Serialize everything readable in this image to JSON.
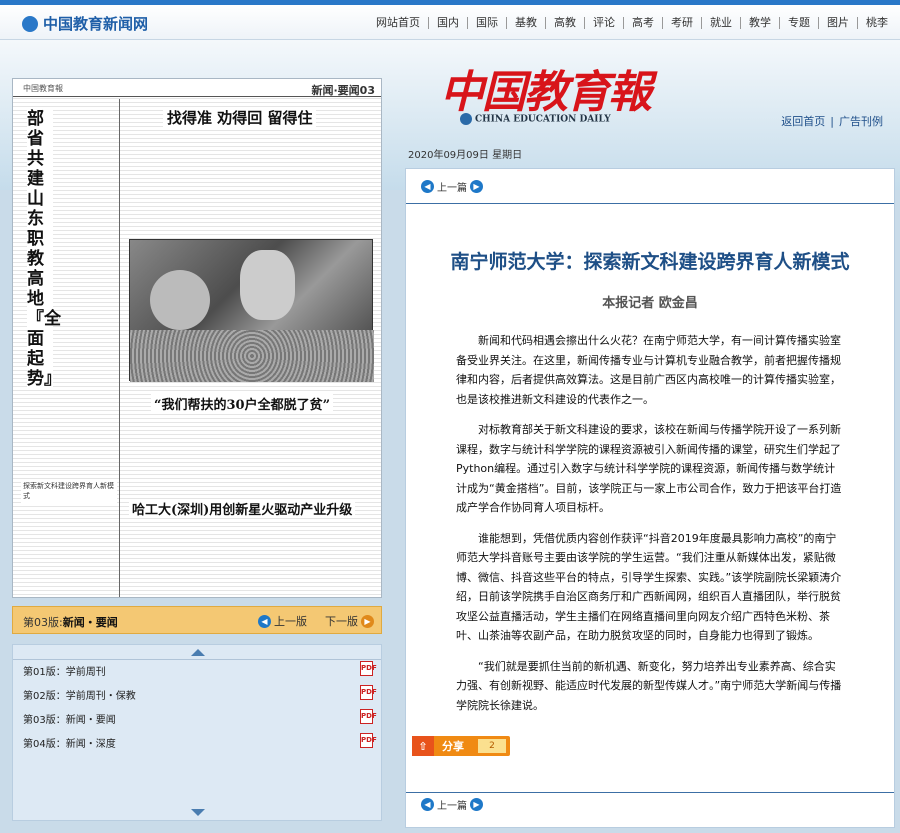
{
  "site": {
    "logo": "中国教育新闻网"
  },
  "topnav": [
    "网站首页",
    "国内",
    "国际",
    "基教",
    "高教",
    "评论",
    "高考",
    "考研",
    "就业",
    "教学",
    "专题",
    "图片",
    "桃李"
  ],
  "masthead": {
    "title": "中国教育報",
    "subtitle": "CHINA EDUCATION DAILY"
  },
  "header_links": {
    "home": "返回首页",
    "ad": "广告刊例"
  },
  "date": "2020年09月09日 星期日",
  "newspaper": {
    "edition_title": "新闻·要闻03",
    "vertical_headline": "部省共建山东职教高地『全面起势』",
    "headline1": "找得准 劝得回 留得住",
    "headline2": "“我们帮扶的30户全都脱了贫”",
    "headline3": "哈工大(深圳)用创新星火驱动产业升级",
    "side_note": "探索新文科建设跨界育人新模式"
  },
  "version_bar": {
    "prefix": "第03版:",
    "name": "新闻・要闻",
    "prev": "上一版",
    "next": "下一版"
  },
  "editions": [
    {
      "label": "第01版：学前周刊"
    },
    {
      "label": "第02版：学前周刊・保教"
    },
    {
      "label": "第03版：新闻・要闻"
    },
    {
      "label": "第04版：新闻・深度"
    }
  ],
  "article": {
    "prev_label": "上一篇",
    "title": "南宁师范大学：探索新文科建设跨界育人新模式",
    "author": "本报记者 欧金昌",
    "paragraphs": [
      "新闻和代码相遇会擦出什么火花？在南宁师范大学，有一间计算传播实验室备受业界关注。在这里，新闻传播专业与计算机专业融合教学，前者把握传播规律和内容，后者提供高效算法。这是目前广西区内高校唯一的计算传播实验室，也是该校推进新文科建设的代表作之一。",
      "对标教育部关于新文科建设的要求，该校在新闻与传播学院开设了一系列新课程，数字与统计科学学院的课程资源被引入新闻传播的课堂，研究生们学起了Python编程。通过引入数字与统计科学学院的课程资源，新闻传播与数学统计计成为“黄金搭档”。目前，该学院正与一家上市公司合作，致力于把该平台打造成产学合作协同育人项目标杆。",
      "谁能想到，凭借优质内容创作获评“抖音2019年度最具影响力高校”的南宁师范大学抖音账号主要由该学院的学生运营。“我们注重从新媒体出发，紧贴微博、微信、抖音这些平台的特点，引导学生探索、实践。”该学院副院长梁颖涛介绍，日前该学院携手自治区商务厅和广西新闻网，组织百人直播团队，举行脱贫攻坚公益直播活动，学生主播们在网络直播间里向网友介绍广西特色米粉、茶叶、山茶油等农副产品，在助力脱贫攻坚的同时，自身能力也得到了锻炼。",
      "“我们就是要抓住当前的新机遇、新变化，努力培养出专业素养高、综合实力强、有创新视野、能适应时代发展的新型传媒人才。”南宁师范大学新闻与传播学院院长徐建说。"
    ],
    "share_label": "分享",
    "share_count": "2"
  },
  "colors": {
    "accent": "#2a78c8",
    "title_blue": "#1e4f86",
    "masthead_red": "#d8141a",
    "version_bar": "#f4c873"
  }
}
